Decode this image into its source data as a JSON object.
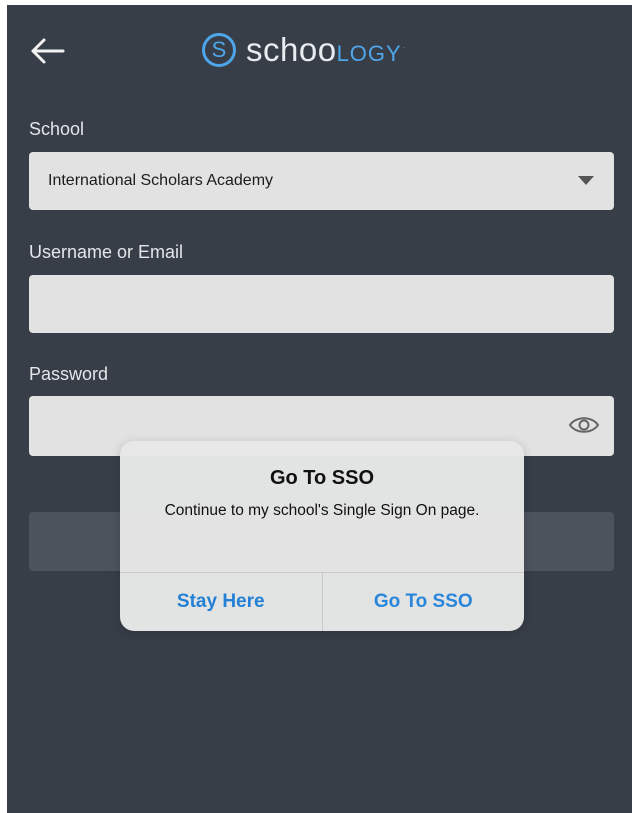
{
  "header": {
    "back_icon": "arrow-left-icon",
    "logo": {
      "mark": "S",
      "text_main": "schoo",
      "text_accent": "LOGY",
      "trademark": "·"
    }
  },
  "form": {
    "school": {
      "label": "School",
      "value": "International Scholars Academy",
      "icon": "caret-down-icon"
    },
    "username": {
      "label": "Username or Email",
      "value": ""
    },
    "password": {
      "label": "Password",
      "value": "",
      "icon": "eye-icon"
    }
  },
  "alert": {
    "title": "Go To SSO",
    "message": "Continue to my school's Single Sign On page.",
    "cancel_label": "Stay Here",
    "confirm_label": "Go To SSO"
  },
  "colors": {
    "background": "#383e48",
    "accent": "#4ea6ea",
    "field": "#e2e2e2",
    "alert_button": "#2380d6"
  }
}
